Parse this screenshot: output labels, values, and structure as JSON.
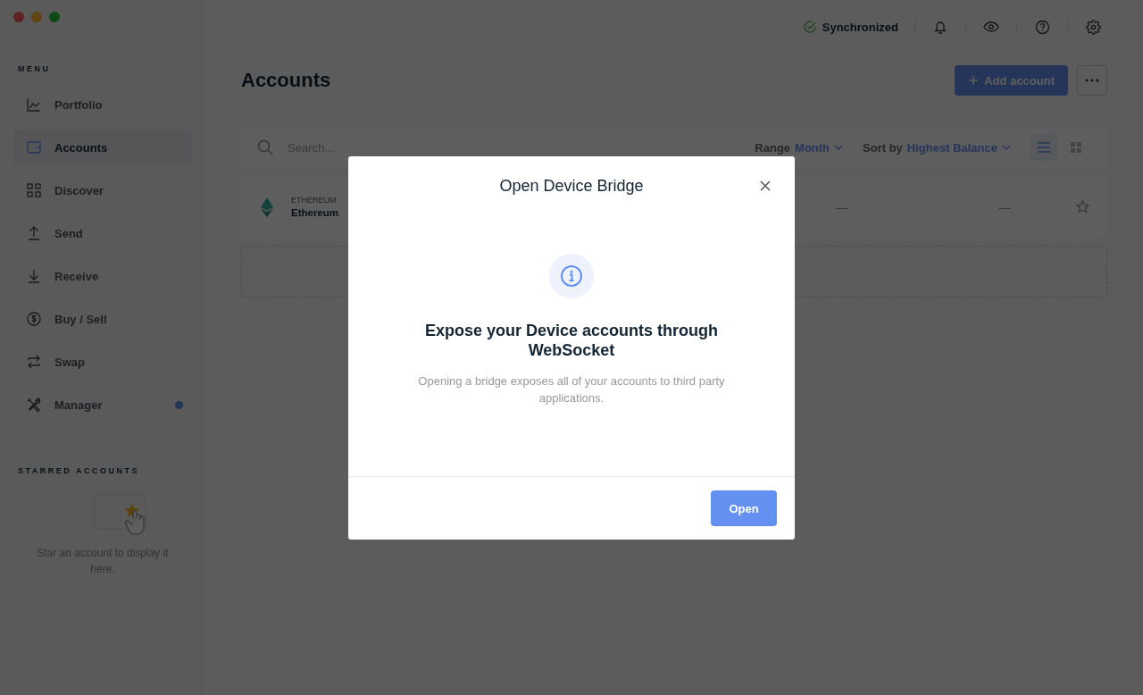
{
  "top_bar": {
    "sync_status": "Synchronized"
  },
  "sidebar": {
    "menu_heading": "MENU",
    "items": [
      {
        "label": "Portfolio",
        "selected": false,
        "notification": false
      },
      {
        "label": "Accounts",
        "selected": true,
        "notification": false
      },
      {
        "label": "Discover",
        "selected": false,
        "notification": false
      },
      {
        "label": "Send",
        "selected": false,
        "notification": false
      },
      {
        "label": "Receive",
        "selected": false,
        "notification": false
      },
      {
        "label": "Buy / Sell",
        "selected": false,
        "notification": false
      },
      {
        "label": "Swap",
        "selected": false,
        "notification": false
      },
      {
        "label": "Manager",
        "selected": false,
        "notification": true
      }
    ],
    "starred_heading": "STARRED ACCOUNTS",
    "starred_empty": "Star an account to display it here."
  },
  "page": {
    "title": "Accounts",
    "add_button": "Add account"
  },
  "filters": {
    "search_placeholder": "Search...",
    "range_label": "Range",
    "range_value": "Month",
    "sort_label": "Sort by",
    "sort_value": "Highest Balance",
    "views": [
      {
        "selected": true
      },
      {
        "selected": false
      }
    ]
  },
  "accounts": [
    {
      "currency": "ETHEREUM",
      "name": "Ethereum",
      "column_3": "—",
      "column_4": "—",
      "starred": false
    }
  ],
  "dialog": {
    "title": "Open Device Bridge",
    "heading": "Expose your Device accounts through WebSocket",
    "description": "Opening a bridge exposes all of your accounts to third party applications.",
    "button": "Open"
  }
}
